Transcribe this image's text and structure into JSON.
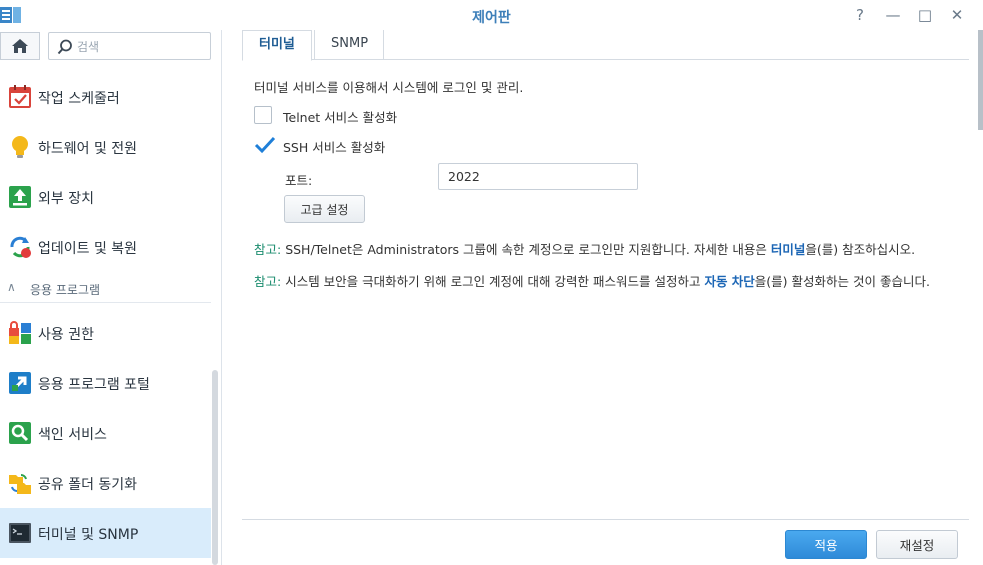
{
  "window": {
    "title": "제어판",
    "help_glyph": "?",
    "min_glyph": "—",
    "max_glyph": "□",
    "close_glyph": "✕"
  },
  "sidebar": {
    "search_placeholder": "검색",
    "items": [
      {
        "label": "작업 스케줄러",
        "icon": "calendar-check-icon"
      },
      {
        "label": "하드웨어 및 전원",
        "icon": "lightbulb-icon"
      },
      {
        "label": "외부 장치",
        "icon": "external-device-icon"
      },
      {
        "label": "업데이트 및 복원",
        "icon": "update-restore-icon"
      }
    ],
    "section": {
      "label": "응용 프로그램",
      "chevron": "∧"
    },
    "section_items": [
      {
        "label": "사용 권한",
        "icon": "privileges-icon"
      },
      {
        "label": "응용 프로그램 포털",
        "icon": "app-portal-icon"
      },
      {
        "label": "색인 서비스",
        "icon": "indexing-icon"
      },
      {
        "label": "공유 폴더 동기화",
        "icon": "folder-sync-icon"
      },
      {
        "label": "터미널 및 SNMP",
        "icon": "terminal-icon",
        "active": true
      }
    ]
  },
  "tabs": [
    {
      "label": "터미널",
      "active": true
    },
    {
      "label": "SNMP",
      "active": false
    }
  ],
  "terminal": {
    "description": "터미널 서비스를 이용해서 시스템에 로그인 및 관리.",
    "telnet": {
      "label": "Telnet 서비스 활성화",
      "checked": false
    },
    "ssh": {
      "label": "SSH 서비스 활성화",
      "checked": true
    },
    "port_label": "포트:",
    "port_value": "2022",
    "advanced_button": "고급 설정"
  },
  "notes": [
    {
      "tag": "참고:",
      "before": " SSH/Telnet은 Administrators 그룹에 속한 계정으로 로그인만 지원합니다. 자세한 내용은 ",
      "link": "터미널",
      "after": "을(를) 참조하십시오."
    },
    {
      "tag": "참고:",
      "before": " 시스템 보안을 극대화하기 위해 로그인 계정에 대해 강력한 패스워드를 설정하고 ",
      "link": "자동 차단",
      "after": "을(를) 활성화하는 것이 좋습니다."
    }
  ],
  "footer": {
    "apply_label": "적용",
    "reset_label": "재설정"
  },
  "colors": {
    "accent": "#3d7fb9",
    "apply_bg": "#3b9be6",
    "active_nav_bg": "#d9ecfb",
    "note_tag": "#1a8c6e",
    "link": "#1c66b5"
  }
}
